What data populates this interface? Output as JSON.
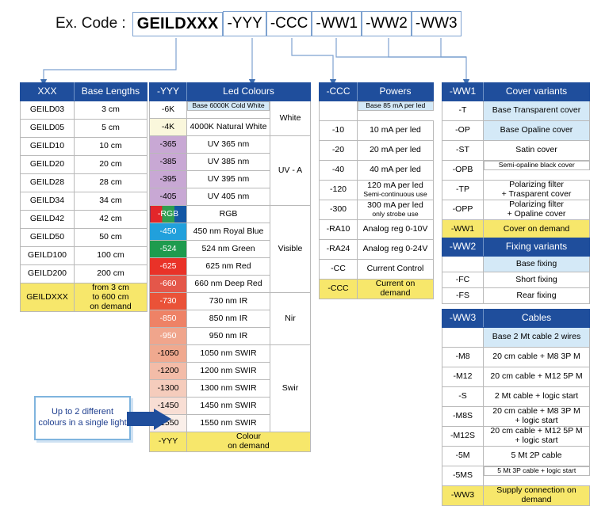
{
  "header": {
    "label": "Ex. Code :",
    "segments": [
      {
        "text": "GEILDXXX",
        "main": true
      },
      {
        "text": "-YYY",
        "main": false
      },
      {
        "text": "-CCC",
        "main": false
      },
      {
        "text": "-WW1",
        "main": false
      },
      {
        "text": "-WW2",
        "main": false
      },
      {
        "text": "-WW3",
        "main": false
      }
    ]
  },
  "colors": {
    "header_blue": "#1F4E9C",
    "base_highlight": "#D4E9F7",
    "on_demand_yellow": "#F7E76B",
    "connector_blue": "#7EA2D0",
    "note_text": "#1F3F8F"
  },
  "tables": {
    "lengths": {
      "header": {
        "code": "XXX",
        "desc": "Base Lengths"
      },
      "rows": [
        {
          "code": "GEILD03",
          "desc": "3 cm",
          "style": "base"
        },
        {
          "code": "GEILD05",
          "desc": "5 cm",
          "style": "base"
        },
        {
          "code": "GEILD10",
          "desc": "10 cm",
          "style": "base"
        },
        {
          "code": "GEILD20",
          "desc": "20 cm",
          "style": "base"
        },
        {
          "code": "GEILD28",
          "desc": "28 cm",
          "style": "base"
        },
        {
          "code": "GEILD34",
          "desc": "34 cm",
          "style": "base"
        },
        {
          "code": "GEILD42",
          "desc": "42 cm",
          "style": "base"
        },
        {
          "code": "GEILD50",
          "desc": "50 cm",
          "style": "base"
        },
        {
          "code": "GEILD100",
          "desc": "100 cm",
          "style": "base"
        },
        {
          "code": "GEILD200",
          "desc": "200 cm",
          "style": "base"
        },
        {
          "code": "GEILDXXX",
          "desc": "from 3 cm\nto 600 cm\non demand",
          "style": "demand"
        }
      ]
    },
    "colours": {
      "header": {
        "code": "-YYY",
        "desc": "Led Colours",
        "group": ""
      },
      "rows": [
        {
          "code": "-6K",
          "desc": "Base 6000K Cold White",
          "swatch": "sw-white",
          "descStyle": "base-hl",
          "small": true
        },
        {
          "code": "-4K",
          "desc": "4000K Natural White",
          "swatch": "sw-cream",
          "descStyle": ""
        },
        {
          "code": "-365",
          "desc": "UV 365 nm",
          "swatch": "sw-uv",
          "descStyle": ""
        },
        {
          "code": "-385",
          "desc": "UV 385 nm",
          "swatch": "sw-uv",
          "descStyle": ""
        },
        {
          "code": "-395",
          "desc": "UV 395 nm",
          "swatch": "sw-uv",
          "descStyle": ""
        },
        {
          "code": "-405",
          "desc": "UV 405 nm",
          "swatch": "sw-uv",
          "descStyle": ""
        },
        {
          "code": "-RGB",
          "desc": "RGB",
          "swatch": "sw-rgb",
          "descStyle": ""
        },
        {
          "code": "-450",
          "desc": "450 nm Royal Blue",
          "swatch": "sw-blue",
          "descStyle": ""
        },
        {
          "code": "-524",
          "desc": "524 nm Green",
          "swatch": "sw-green",
          "descStyle": ""
        },
        {
          "code": "-625",
          "desc": "625 nm Red",
          "swatch": "sw-r625",
          "descStyle": ""
        },
        {
          "code": "-660",
          "desc": "660 nm Deep Red",
          "swatch": "sw-r660",
          "descStyle": ""
        },
        {
          "code": "-730",
          "desc": "730 nm IR",
          "swatch": "sw-r730",
          "descStyle": ""
        },
        {
          "code": "-850",
          "desc": "850 nm IR",
          "swatch": "sw-r850",
          "descStyle": ""
        },
        {
          "code": "-950",
          "desc": "950 nm IR",
          "swatch": "sw-r950",
          "descStyle": ""
        },
        {
          "code": "-1050",
          "desc": "1050 nm SWIR",
          "swatch": "sw-1050",
          "descStyle": ""
        },
        {
          "code": "-1200",
          "desc": "1200 nm SWIR",
          "swatch": "sw-1200",
          "descStyle": ""
        },
        {
          "code": "-1300",
          "desc": "1300 nm SWIR",
          "swatch": "sw-1300",
          "descStyle": ""
        },
        {
          "code": "-1450",
          "desc": "1450 nm SWIR",
          "swatch": "sw-1450",
          "descStyle": ""
        },
        {
          "code": "-1550",
          "desc": "1550 nm SWIR",
          "swatch": "sw-1550",
          "descStyle": ""
        },
        {
          "code": "-YYY",
          "desc": "Colour\non demand",
          "swatch": "demand",
          "descStyle": "demand"
        }
      ],
      "groups": [
        {
          "label": "White",
          "span": 2
        },
        {
          "label": "UV - A",
          "span": 4
        },
        {
          "label": "Visible",
          "span": 5
        },
        {
          "label": "Nir",
          "span": 3
        },
        {
          "label": "Swir",
          "span": 5
        }
      ]
    },
    "powers": {
      "header": {
        "code": "-CCC",
        "desc": "Powers"
      },
      "rows": [
        {
          "code": "",
          "desc": "Base 85 mA per led",
          "style": "base-hl",
          "small": true
        },
        {
          "code": "-10",
          "desc": "10 mA per led",
          "style": ""
        },
        {
          "code": "-20",
          "desc": "20 mA per led",
          "style": ""
        },
        {
          "code": "-40",
          "desc": "40 mA per led",
          "style": ""
        },
        {
          "code": "-120",
          "desc": "120 mA per led",
          "sub": "Semi-continuous use",
          "style": ""
        },
        {
          "code": "-300",
          "desc": "300 mA per led",
          "sub": "only strobe use",
          "style": ""
        },
        {
          "code": "-RA10",
          "desc": "Analog reg 0-10V",
          "style": ""
        },
        {
          "code": "-RA24",
          "desc": "Analog reg 0-24V",
          "style": ""
        },
        {
          "code": "-CC",
          "desc": "Current Control",
          "style": ""
        },
        {
          "code": "-CCC",
          "desc": "Current on\ndemand",
          "style": "demand"
        }
      ]
    },
    "cover": {
      "header": {
        "code": "-WW1",
        "desc": "Cover variants"
      },
      "rows": [
        {
          "code": "-T",
          "desc": "Base Transparent cover",
          "style": "base-hl"
        },
        {
          "code": "-OP",
          "desc": "Base Opaline cover",
          "style": "base-hl"
        },
        {
          "code": "-ST",
          "desc": "Satin cover",
          "style": ""
        },
        {
          "code": "-OPB",
          "desc": "Semi-opaline black cover",
          "style": "",
          "small": true
        },
        {
          "code": "-TP",
          "desc": "Polarizing filter\n+ Trasparent cover",
          "style": ""
        },
        {
          "code": "-OPP",
          "desc": "Polarizing filter\n+ Opaline cover",
          "style": ""
        },
        {
          "code": "-WW1",
          "desc": "Cover on demand",
          "style": "demand"
        }
      ]
    },
    "fixing": {
      "header": {
        "code": "-WW2",
        "desc": "Fixing variants"
      },
      "rows": [
        {
          "code": "",
          "desc": "Base fixing",
          "style": "base-hl"
        },
        {
          "code": "-FC",
          "desc": "Short fixing",
          "style": ""
        },
        {
          "code": "-FS",
          "desc": "Rear fixing",
          "style": ""
        }
      ]
    },
    "cables": {
      "header": {
        "code": "-WW3",
        "desc": "Cables"
      },
      "rows": [
        {
          "code": "",
          "desc": "Base 2 Mt cable 2 wires",
          "style": "base-hl"
        },
        {
          "code": "-M8",
          "desc": "20 cm cable + M8 3P M",
          "style": ""
        },
        {
          "code": "-M12",
          "desc": "20 cm cable + M12 5P M",
          "style": ""
        },
        {
          "code": "-S",
          "desc": "2 Mt cable + logic start",
          "style": ""
        },
        {
          "code": "-M8S",
          "desc": "20 cm cable + M8 3P M\n+ logic start",
          "style": ""
        },
        {
          "code": "-M12S",
          "desc": "20 cm cable + M12 5P M\n+ logic start",
          "style": ""
        },
        {
          "code": "-5M",
          "desc": "5 Mt 2P cable",
          "style": ""
        },
        {
          "code": "-5MS",
          "desc": "5 Mt 3P cable + logic start",
          "style": "",
          "small": true
        },
        {
          "code": "-WW3",
          "desc": "Supply connection on\ndemand",
          "style": "demand"
        }
      ]
    }
  },
  "note": {
    "text": "Up to 2 different colours in a single light"
  }
}
